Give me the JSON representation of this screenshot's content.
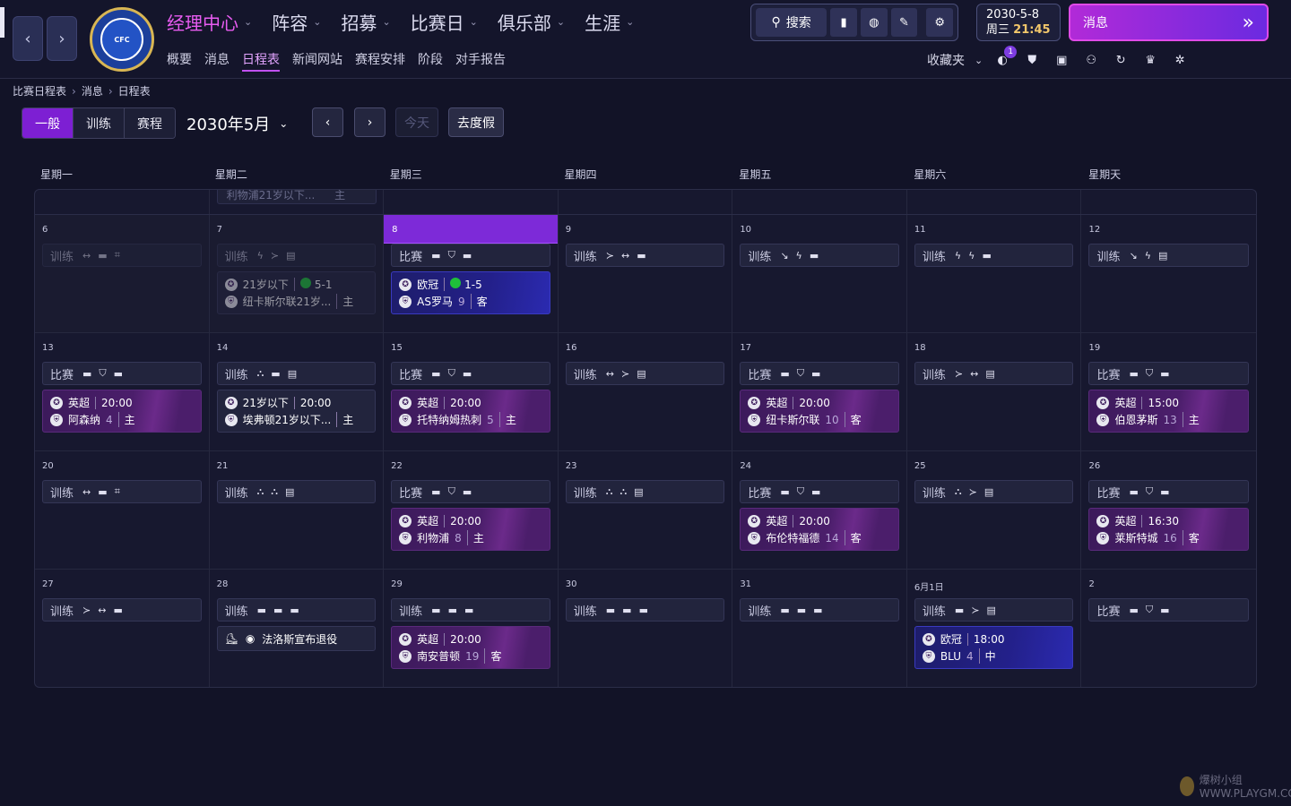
{
  "header": {
    "back_icon": "chevron-left",
    "forward_icon": "chevron-right",
    "club_crest": "CHELSEA FOOTBALL CLUB",
    "main_nav": [
      {
        "label": "经理中心",
        "active": true
      },
      {
        "label": "阵容",
        "active": false
      },
      {
        "label": "招募",
        "active": false
      },
      {
        "label": "比赛日",
        "active": false
      },
      {
        "label": "俱乐部",
        "active": false
      },
      {
        "label": "生涯",
        "active": false
      }
    ],
    "sub_nav": [
      {
        "label": "概要",
        "active": false
      },
      {
        "label": "消息",
        "active": false
      },
      {
        "label": "日程表",
        "active": true
      },
      {
        "label": "新闻网站",
        "active": false
      },
      {
        "label": "赛程安排",
        "active": false
      },
      {
        "label": "阶段",
        "active": false
      },
      {
        "label": "对手报告",
        "active": false
      }
    ],
    "search_label": "搜索",
    "date": "2030-5-8",
    "weekday": "周三",
    "time": "21:45",
    "message_button": "消息",
    "favorites_label": "收藏夹",
    "notification_count": "1"
  },
  "breadcrumb": [
    "比赛日程表",
    "消息",
    "日程表"
  ],
  "controls": {
    "view_tabs": [
      {
        "label": "一般",
        "active": true
      },
      {
        "label": "训练",
        "active": false
      },
      {
        "label": "赛程",
        "active": false
      }
    ],
    "month": "2030年5月",
    "today_label": "今天",
    "vacation_label": "去度假"
  },
  "weekdays": [
    "星期一",
    "星期二",
    "星期三",
    "星期四",
    "星期五",
    "星期六",
    "星期天"
  ],
  "prev_week_ghost": "利物浦21岁以下...",
  "prev_week_ghost_ha": "主",
  "weeks": [
    [
      {
        "day": "6",
        "past": true,
        "event": {
          "type": "训练",
          "icons": [
            "↔",
            "▬",
            "⌗"
          ],
          "dim": true
        }
      },
      {
        "day": "7",
        "past": true,
        "event": {
          "type": "训练",
          "icons": [
            "ϟ",
            "≻",
            "▤"
          ],
          "dim": true
        },
        "match": {
          "kind": "u21 dim",
          "comp": "21岁以下",
          "result": "5-1",
          "opponent": "纽卡斯尔联21岁...",
          "ha": "主"
        }
      },
      {
        "day": "8",
        "today": true,
        "event": {
          "type": "比赛",
          "icons": [
            "▬",
            "⛉",
            "▬"
          ]
        },
        "match": {
          "kind": "ucl",
          "comp": "欧冠",
          "result": "1-5",
          "opponent": "AS罗马",
          "rank": "9",
          "ha": "客"
        }
      },
      {
        "day": "9",
        "event": {
          "type": "训练",
          "icons": [
            "≻",
            "↔",
            "▬"
          ]
        }
      },
      {
        "day": "10",
        "event": {
          "type": "训练",
          "icons": [
            "↘",
            "ϟ",
            "▬"
          ]
        }
      },
      {
        "day": "11",
        "event": {
          "type": "训练",
          "icons": [
            "ϟ",
            "ϟ",
            "▬"
          ]
        }
      },
      {
        "day": "12",
        "event": {
          "type": "训练",
          "icons": [
            "↘",
            "ϟ",
            "▤"
          ]
        }
      }
    ],
    [
      {
        "day": "13",
        "event": {
          "type": "比赛",
          "icons": [
            "▬",
            "⛉",
            "▬"
          ]
        },
        "match": {
          "kind": "epl",
          "comp": "英超",
          "time": "20:00",
          "opponent": "阿森纳",
          "rank": "4",
          "ha": "主"
        }
      },
      {
        "day": "14",
        "event": {
          "type": "训练",
          "icons": [
            "⛬",
            "▬",
            "▤"
          ]
        },
        "match": {
          "kind": "u21",
          "comp": "21岁以下",
          "time": "20:00",
          "opponent": "埃弗顿21岁以下...",
          "ha": "主"
        }
      },
      {
        "day": "15",
        "event": {
          "type": "比赛",
          "icons": [
            "▬",
            "⛉",
            "▬"
          ]
        },
        "match": {
          "kind": "epl",
          "comp": "英超",
          "time": "20:00",
          "opponent": "托特纳姆热刺",
          "rank": "5",
          "ha": "主"
        }
      },
      {
        "day": "16",
        "event": {
          "type": "训练",
          "icons": [
            "↔",
            "≻",
            "▤"
          ]
        }
      },
      {
        "day": "17",
        "event": {
          "type": "比赛",
          "icons": [
            "▬",
            "⛉",
            "▬"
          ]
        },
        "match": {
          "kind": "epl",
          "comp": "英超",
          "time": "20:00",
          "opponent": "纽卡斯尔联",
          "rank": "10",
          "ha": "客"
        }
      },
      {
        "day": "18",
        "event": {
          "type": "训练",
          "icons": [
            "≻",
            "↔",
            "▤"
          ]
        }
      },
      {
        "day": "19",
        "event": {
          "type": "比赛",
          "icons": [
            "▬",
            "⛉",
            "▬"
          ]
        },
        "match": {
          "kind": "epl",
          "comp": "英超",
          "time": "15:00",
          "opponent": "伯恩茅斯",
          "rank": "13",
          "ha": "主"
        }
      }
    ],
    [
      {
        "day": "20",
        "event": {
          "type": "训练",
          "icons": [
            "↔",
            "▬",
            "⌗"
          ]
        }
      },
      {
        "day": "21",
        "event": {
          "type": "训练",
          "icons": [
            "⛬",
            "⛬",
            "▤"
          ]
        }
      },
      {
        "day": "22",
        "event": {
          "type": "比赛",
          "icons": [
            "▬",
            "⛉",
            "▬"
          ]
        },
        "match": {
          "kind": "epl",
          "comp": "英超",
          "time": "20:00",
          "opponent": "利物浦",
          "rank": "8",
          "ha": "主"
        }
      },
      {
        "day": "23",
        "event": {
          "type": "训练",
          "icons": [
            "⛬",
            "⛬",
            "▤"
          ]
        }
      },
      {
        "day": "24",
        "event": {
          "type": "比赛",
          "icons": [
            "▬",
            "⛉",
            "▬"
          ]
        },
        "match": {
          "kind": "epl",
          "comp": "英超",
          "time": "20:00",
          "opponent": "布伦特福德",
          "rank": "14",
          "ha": "客"
        }
      },
      {
        "day": "25",
        "event": {
          "type": "训练",
          "icons": [
            "⛬",
            "≻",
            "▤"
          ]
        }
      },
      {
        "day": "26",
        "event": {
          "type": "比赛",
          "icons": [
            "▬",
            "⛉",
            "▬"
          ]
        },
        "match": {
          "kind": "epl",
          "comp": "英超",
          "time": "16:30",
          "opponent": "莱斯特城",
          "rank": "16",
          "ha": "客"
        }
      }
    ],
    [
      {
        "day": "27",
        "event": {
          "type": "训练",
          "icons": [
            "≻",
            "↔",
            "▬"
          ]
        }
      },
      {
        "day": "28",
        "event": {
          "type": "训练",
          "icons": [
            "▬",
            "▬",
            "▬"
          ]
        },
        "match": {
          "kind": "news",
          "text": "法洛斯宣布退役"
        }
      },
      {
        "day": "29",
        "event": {
          "type": "训练",
          "icons": [
            "▬",
            "▬",
            "▬"
          ]
        },
        "match": {
          "kind": "epl",
          "comp": "英超",
          "time": "20:00",
          "opponent": "南安普顿",
          "rank": "19",
          "ha": "客"
        }
      },
      {
        "day": "30",
        "event": {
          "type": "训练",
          "icons": [
            "▬",
            "▬",
            "▬"
          ]
        }
      },
      {
        "day": "31",
        "event": {
          "type": "训练",
          "icons": [
            "▬",
            "▬",
            "▬"
          ]
        }
      },
      {
        "day": "6月1日",
        "event": {
          "type": "训练",
          "icons": [
            "▬",
            "≻",
            "▤"
          ]
        },
        "match": {
          "kind": "ucl",
          "comp": "欧冠",
          "time": "18:00",
          "opponent": "BLU",
          "rank": "4",
          "ha": "中"
        }
      },
      {
        "day": "2",
        "event": {
          "type": "比赛",
          "icons": [
            "▬",
            "⛉",
            "▬"
          ]
        }
      }
    ]
  ],
  "watermark": "爆树小组 WWW.PLAYGM.CC"
}
